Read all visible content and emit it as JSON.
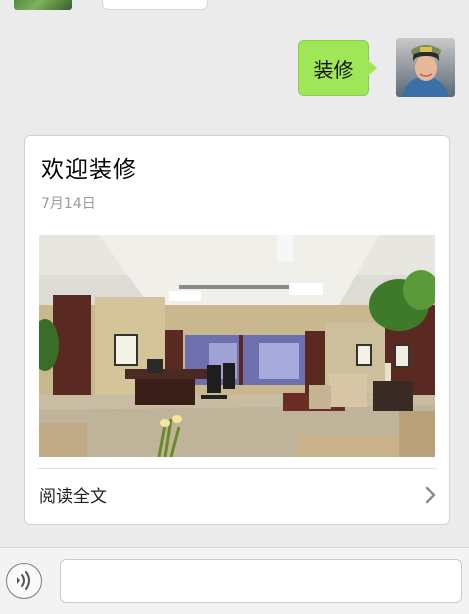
{
  "chat": {
    "outgoing_message": "装修",
    "article": {
      "title": "欢迎装修",
      "date": "7月14日",
      "image_icon": "office-interior-photo",
      "read_full_label": "阅读全文",
      "chevron_icon": "chevron-right-icon"
    }
  },
  "input_bar": {
    "voice_icon": "voice-icon",
    "placeholder": ""
  },
  "colors": {
    "background": "#ebebeb",
    "outgoing_bubble": "#9fe658",
    "card": "#ffffff",
    "date_text": "#9a9a9a"
  }
}
